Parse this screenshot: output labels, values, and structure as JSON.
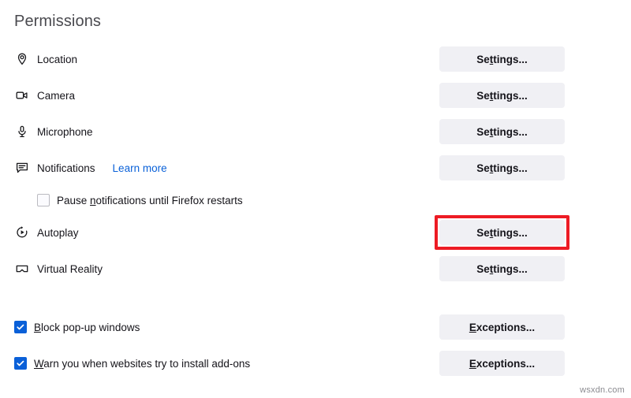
{
  "page_title": "Permissions",
  "colors": {
    "accent_blue": "#0a60d8",
    "link_blue": "#0a61d8",
    "button_bg": "#f0f0f4",
    "highlight_red": "#ed1b24",
    "text": "#15141a",
    "heading": "#4a4a4f"
  },
  "permissions": [
    {
      "label": "Location",
      "icon": "location-pin-icon",
      "button": {
        "label_pre": "Se",
        "label_key": "t",
        "label_post": "tings...",
        "full": "Settings..."
      },
      "highlighted": false
    },
    {
      "label": "Camera",
      "icon": "camera-icon",
      "button": {
        "label_pre": "Se",
        "label_key": "t",
        "label_post": "tings...",
        "full": "Settings..."
      },
      "highlighted": false
    },
    {
      "label": "Microphone",
      "icon": "microphone-icon",
      "button": {
        "label_pre": "Se",
        "label_key": "t",
        "label_post": "tings...",
        "full": "Settings..."
      },
      "highlighted": false
    },
    {
      "label": "Notifications",
      "icon": "notification-bubble-icon",
      "link": "Learn more",
      "button": {
        "label_pre": "Se",
        "label_key": "t",
        "label_post": "tings...",
        "full": "Settings..."
      },
      "highlighted": false,
      "sub_option": {
        "checked": false,
        "label_pre": "Pause ",
        "label_key": "n",
        "label_post": "otifications until Firefox restarts",
        "full": "Pause notifications until Firefox restarts"
      }
    },
    {
      "label": "Autoplay",
      "icon": "autoplay-icon",
      "button": {
        "label_pre": "Se",
        "label_key": "t",
        "label_post": "tings...",
        "full": "Settings..."
      },
      "highlighted": true
    },
    {
      "label": "Virtual Reality",
      "icon": "vr-headset-icon",
      "button": {
        "label_pre": "Se",
        "label_key": "t",
        "label_post": "tings...",
        "full": "Settings..."
      },
      "highlighted": false
    }
  ],
  "options": [
    {
      "checked": true,
      "label_pre": "",
      "label_key": "B",
      "label_post": "lock pop-up windows",
      "full": "Block pop-up windows",
      "button": {
        "label_pre": "",
        "label_key": "E",
        "label_post": "xceptions...",
        "full": "Exceptions..."
      }
    },
    {
      "checked": true,
      "label_pre": "",
      "label_key": "W",
      "label_post": "arn you when websites try to install add-ons",
      "full": "Warn you when websites try to install add-ons",
      "button": {
        "label_pre": "",
        "label_key": "E",
        "label_post": "xceptions...",
        "full": "Exceptions..."
      }
    }
  ],
  "watermark": "wsxdn.com"
}
